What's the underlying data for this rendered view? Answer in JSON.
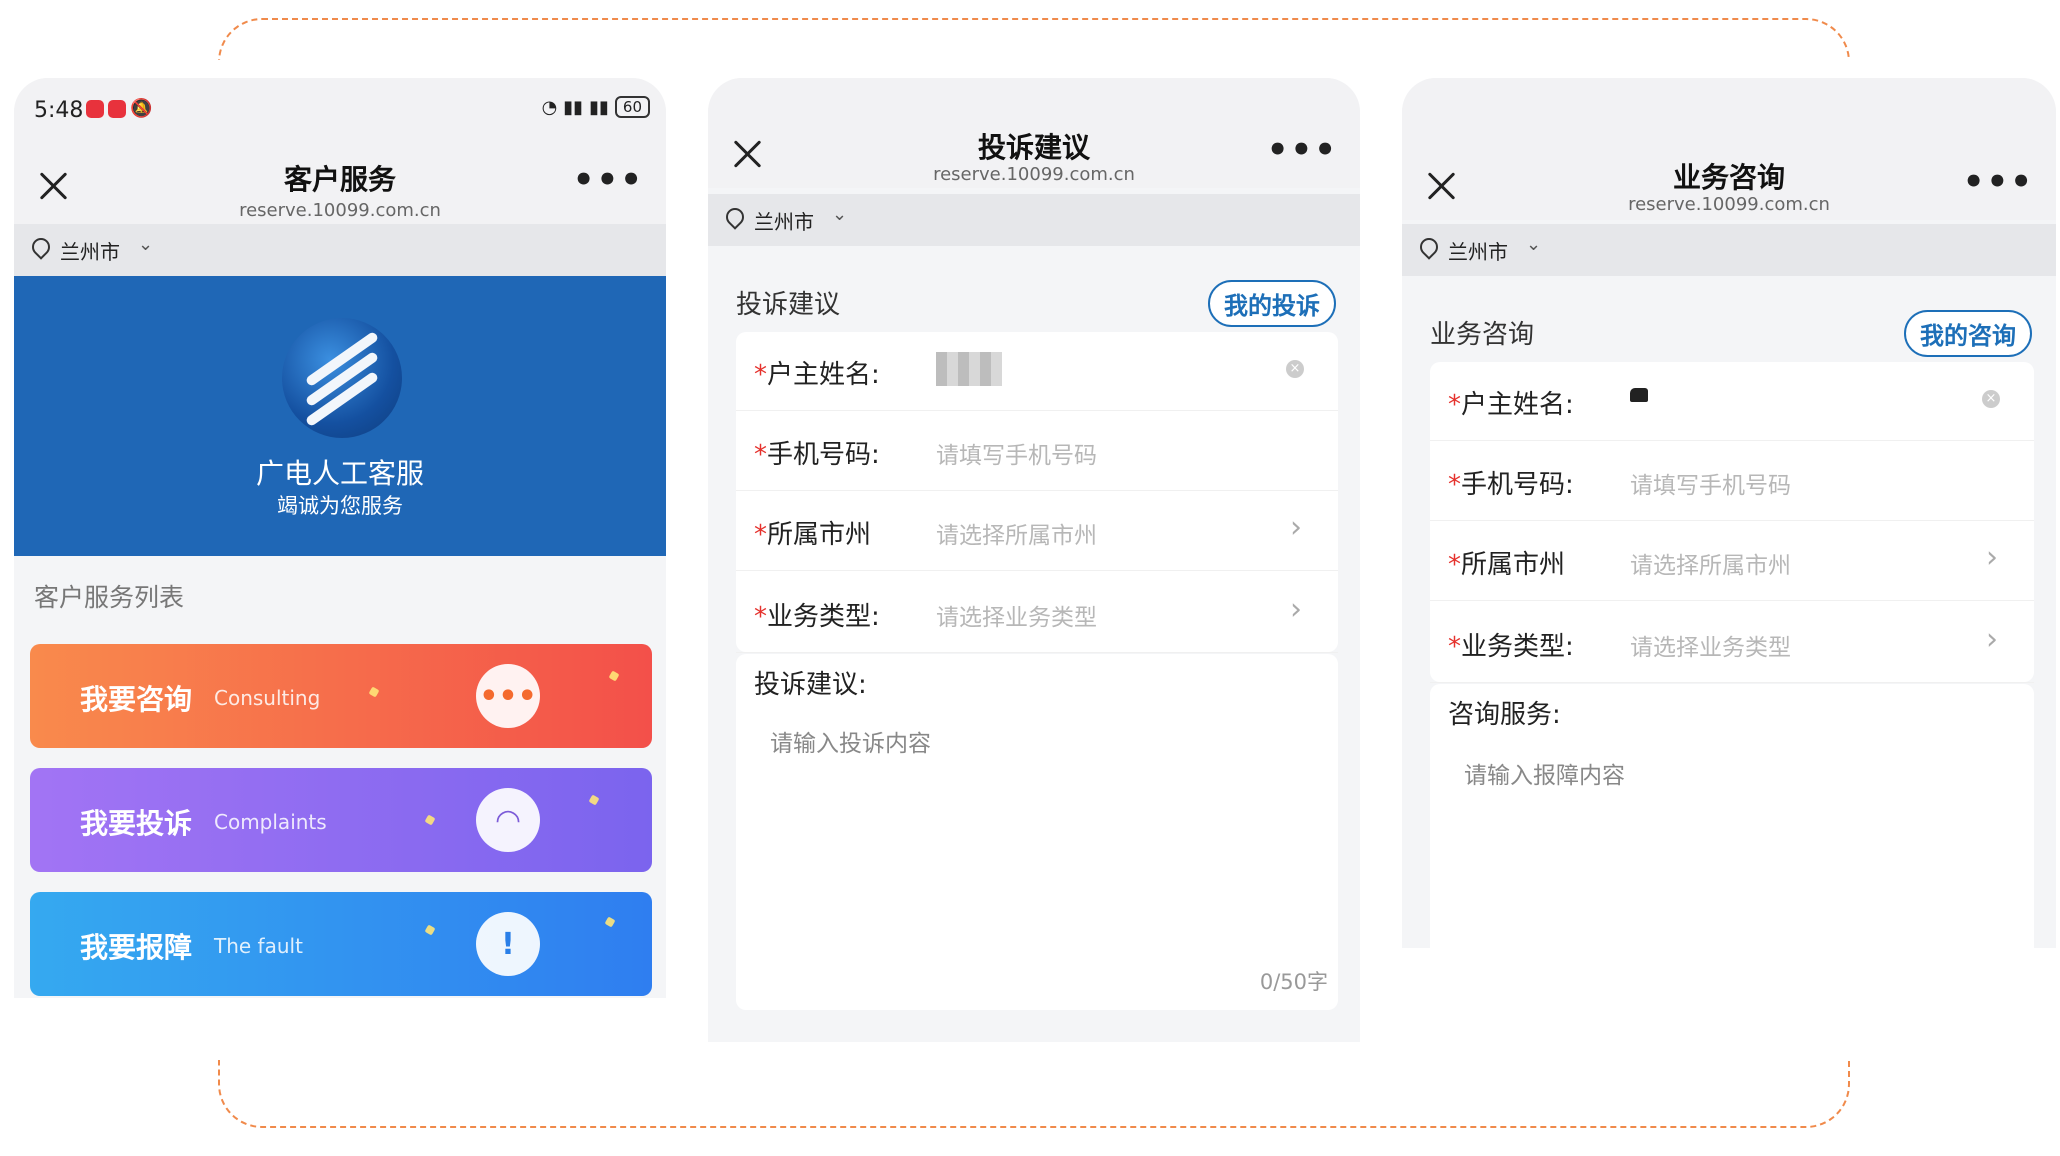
{
  "phone1": {
    "status": {
      "time": "5:48",
      "battery": "60"
    },
    "nav": {
      "title": "客户服务",
      "url": "reserve.10099.com.cn",
      "more": "•••"
    },
    "city": {
      "name": "兰州市",
      "chevron": "⌄"
    },
    "banner": {
      "title": "广电人工客服",
      "subtitle": "竭诚为您服务"
    },
    "list_title": "客户服务列表",
    "services": [
      {
        "label": "我要咨询",
        "en": "Consulting",
        "icon": "chat-headset-icon",
        "glyph": "•••",
        "color": "#f45f3c"
      },
      {
        "label": "我要投诉",
        "en": "Complaints",
        "icon": "complaint-headset-icon",
        "glyph": "◠",
        "color": "#8f63ef"
      },
      {
        "label": "我要报障",
        "en": "The fault",
        "icon": "alert-icon",
        "glyph": "!",
        "color": "#2f8ff0"
      }
    ]
  },
  "phone2": {
    "nav": {
      "title": "投诉建议",
      "url": "reserve.10099.com.cn",
      "more": "•••"
    },
    "city": {
      "name": "兰州市",
      "chevron": "⌄"
    },
    "section_title": "投诉建议",
    "mine_button": "我的投诉",
    "fields": {
      "name": {
        "label": "户主姓名:",
        "star": "*"
      },
      "phone": {
        "label": "手机号码:",
        "star": "*",
        "placeholder": "请填写手机号码"
      },
      "city": {
        "label": "所属市州",
        "star": "*",
        "placeholder": "请选择所属市州"
      },
      "type": {
        "label": "业务类型:",
        "star": "*",
        "placeholder": "请选择业务类型"
      }
    },
    "textarea": {
      "label": "投诉建议:",
      "placeholder": "请输入投诉内容",
      "counter": "0/50字"
    }
  },
  "phone3": {
    "nav": {
      "title": "业务咨询",
      "url": "reserve.10099.com.cn",
      "more": "•••"
    },
    "city": {
      "name": "兰州市",
      "chevron": "⌄"
    },
    "section_title": "业务咨询",
    "mine_button": "我的咨询",
    "fields": {
      "name": {
        "label": "户主姓名:",
        "star": "*"
      },
      "phone": {
        "label": "手机号码:",
        "star": "*",
        "placeholder": "请填写手机号码"
      },
      "city": {
        "label": "所属市州",
        "star": "*",
        "placeholder": "请选择所属市州"
      },
      "type": {
        "label": "业务类型:",
        "star": "*",
        "placeholder": "请选择业务类型"
      }
    },
    "textarea": {
      "label": "咨询服务:",
      "placeholder": "请输入报障内容"
    }
  },
  "colors": {
    "accent": "#1d6fb8",
    "dash": "#f08a4b",
    "required": "#e5322d",
    "banner": "#1f67b6"
  }
}
